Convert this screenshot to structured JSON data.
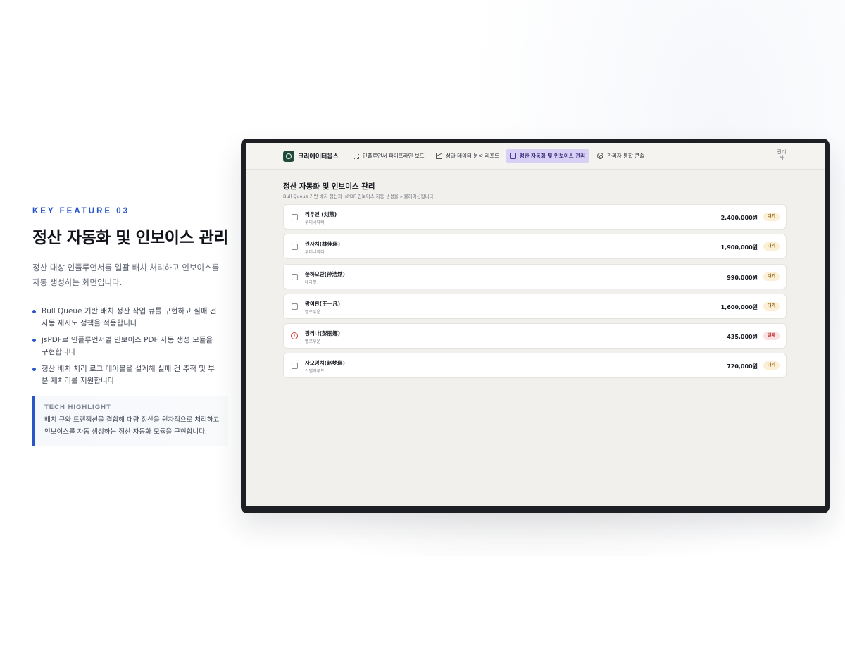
{
  "left": {
    "kicker": "KEY FEATURE 03",
    "title": "정산 자동화 및 인보이스 관리",
    "description": "정산 대상 인플루언서를 일괄 배치 처리하고 인보이스를 자동 생성하는 화면입니다.",
    "bullets": [
      "Bull Queue 기반 배치 정산 작업 큐를 구현하고 실패 건 자동 재시도 정책을 적용합니다",
      "jsPDF로 인플루언서별 인보이스 PDF 자동 생성 모듈을 구현합니다",
      "정산 배치 처리 로그 테이블을 설계해 실패 건 추적 및 부분 재처리를 지원합니다"
    ],
    "highlight": {
      "title": "TECH HIGHLIGHT",
      "text": "배치 큐와 트랜잭션을 결합해 대량 정산을 원자적으로 처리하고 인보이스를 자동 생성하는 정산 자동화 모듈을 구현합니다."
    }
  },
  "app": {
    "brand": "크리에이터옵스",
    "nav": [
      {
        "label": "인플루언서 파이프라인 보드",
        "icon": "grid-icon",
        "active": false
      },
      {
        "label": "성과 데이터 분석 리포트",
        "icon": "chart-icon",
        "active": false
      },
      {
        "label": "정산 자동화 및 인보이스 관리",
        "icon": "card-icon",
        "active": true
      },
      {
        "label": "관리자 통합 콘솔",
        "icon": "gear-icon",
        "active": false
      }
    ],
    "avatar_alt": "관리자",
    "page_title": "정산 자동화 및 인보이스 관리",
    "page_subtitle": "Bull Queue 기반 배치 정산과 jsPDF 인보이스 자동 생성을 시뮬레이션합니다",
    "rows": [
      {
        "name": "리우옌 (刘燕)",
        "agency": "루미네뷰티",
        "amount": "2,400,000원",
        "status": "대기",
        "failed": false
      },
      {
        "name": "린자치(林佳琪)",
        "agency": "루미네뷰티",
        "amount": "1,900,000원",
        "status": "대기",
        "failed": false
      },
      {
        "name": "쑨하오란(孙浩然)",
        "agency": "테라핏",
        "amount": "990,000원",
        "status": "대기",
        "failed": false
      },
      {
        "name": "왕이판(王一凡)",
        "agency": "멜로우운",
        "amount": "1,600,000원",
        "status": "대기",
        "failed": false
      },
      {
        "name": "펑리나(彭丽娜)",
        "agency": "멜로우운",
        "amount": "435,000원",
        "status": "실패",
        "failed": true
      },
      {
        "name": "자오멍치(赵梦琪)",
        "agency": "스텔라푸드",
        "amount": "720,000원",
        "status": "대기",
        "failed": false
      }
    ]
  }
}
